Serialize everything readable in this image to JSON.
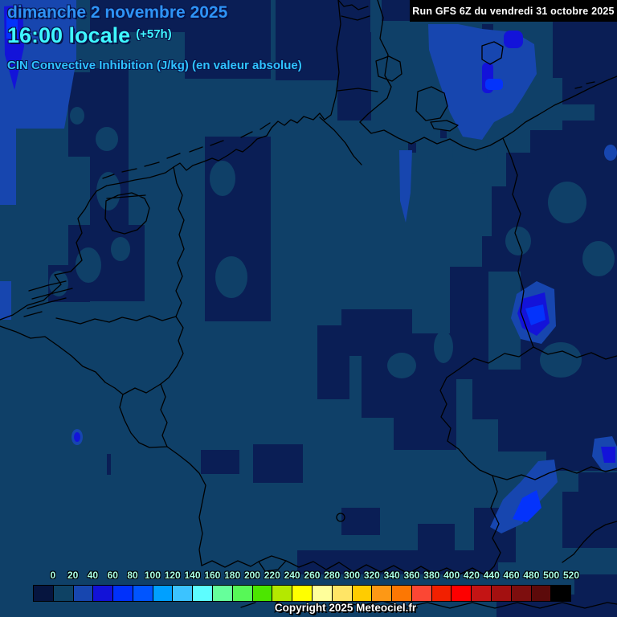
{
  "header": {
    "date": "dimanche 2 novembre 2025",
    "time": "16:00 locale",
    "offset": "(+57h)",
    "subtitle": "CIN Convective Inhibition (J/kg) (en valeur absolue)"
  },
  "run_bar": {
    "text": "Run GFS 6Z du vendredi 31 octobre 2025"
  },
  "footer": {
    "copyright": "Copyright 2025 Meteociel.fr"
  },
  "scale": {
    "unit": "J/kg",
    "items": [
      {
        "label": "0",
        "color": "#06153f"
      },
      {
        "label": "20",
        "color": "#0e4264"
      },
      {
        "label": "40",
        "color": "#1746af"
      },
      {
        "label": "60",
        "color": "#1212d8"
      },
      {
        "label": "80",
        "color": "#0031fb"
      },
      {
        "label": "100",
        "color": "#0055ff"
      },
      {
        "label": "120",
        "color": "#00a0ff"
      },
      {
        "label": "140",
        "color": "#3cc3ff"
      },
      {
        "label": "160",
        "color": "#5dfdff"
      },
      {
        "label": "180",
        "color": "#66ff9b"
      },
      {
        "label": "200",
        "color": "#57f857"
      },
      {
        "label": "220",
        "color": "#4ce600"
      },
      {
        "label": "240",
        "color": "#b4e800"
      },
      {
        "label": "260",
        "color": "#ffff00"
      },
      {
        "label": "280",
        "color": "#ffff9b"
      },
      {
        "label": "300",
        "color": "#ffe566"
      },
      {
        "label": "320",
        "color": "#ffcc00"
      },
      {
        "label": "340",
        "color": "#fd9815"
      },
      {
        "label": "360",
        "color": "#fc7703"
      },
      {
        "label": "380",
        "color": "#fb4734"
      },
      {
        "label": "400",
        "color": "#f22000"
      },
      {
        "label": "420",
        "color": "#fe0000"
      },
      {
        "label": "440",
        "color": "#c41414"
      },
      {
        "label": "460",
        "color": "#a31010"
      },
      {
        "label": "480",
        "color": "#7d0e0e"
      },
      {
        "label": "500",
        "color": "#5c0a0a"
      },
      {
        "label": "520",
        "color": "#000000"
      }
    ]
  },
  "map": {
    "colors": {
      "base": "#0f4068",
      "dark": "#0a1e55",
      "medium": "#1746af",
      "bright": "#1313d9",
      "brightest": "#0433fb",
      "border": "#000000"
    }
  }
}
